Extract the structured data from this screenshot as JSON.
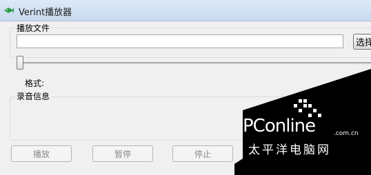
{
  "window": {
    "title": "Verint播放器",
    "icon": "fish-app-icon"
  },
  "file_group": {
    "label": "播放文件",
    "input_value": "",
    "select_button": "选择"
  },
  "slider": {
    "position": 0
  },
  "format": {
    "label": "格式:"
  },
  "record_info": {
    "label": "录音信息"
  },
  "buttons": {
    "play": "播放",
    "pause": "暂停",
    "stop": "停止"
  },
  "watermark": {
    "brand": "PConline",
    "domain": ".com.cn",
    "chinese": "太平洋电脑网"
  }
}
